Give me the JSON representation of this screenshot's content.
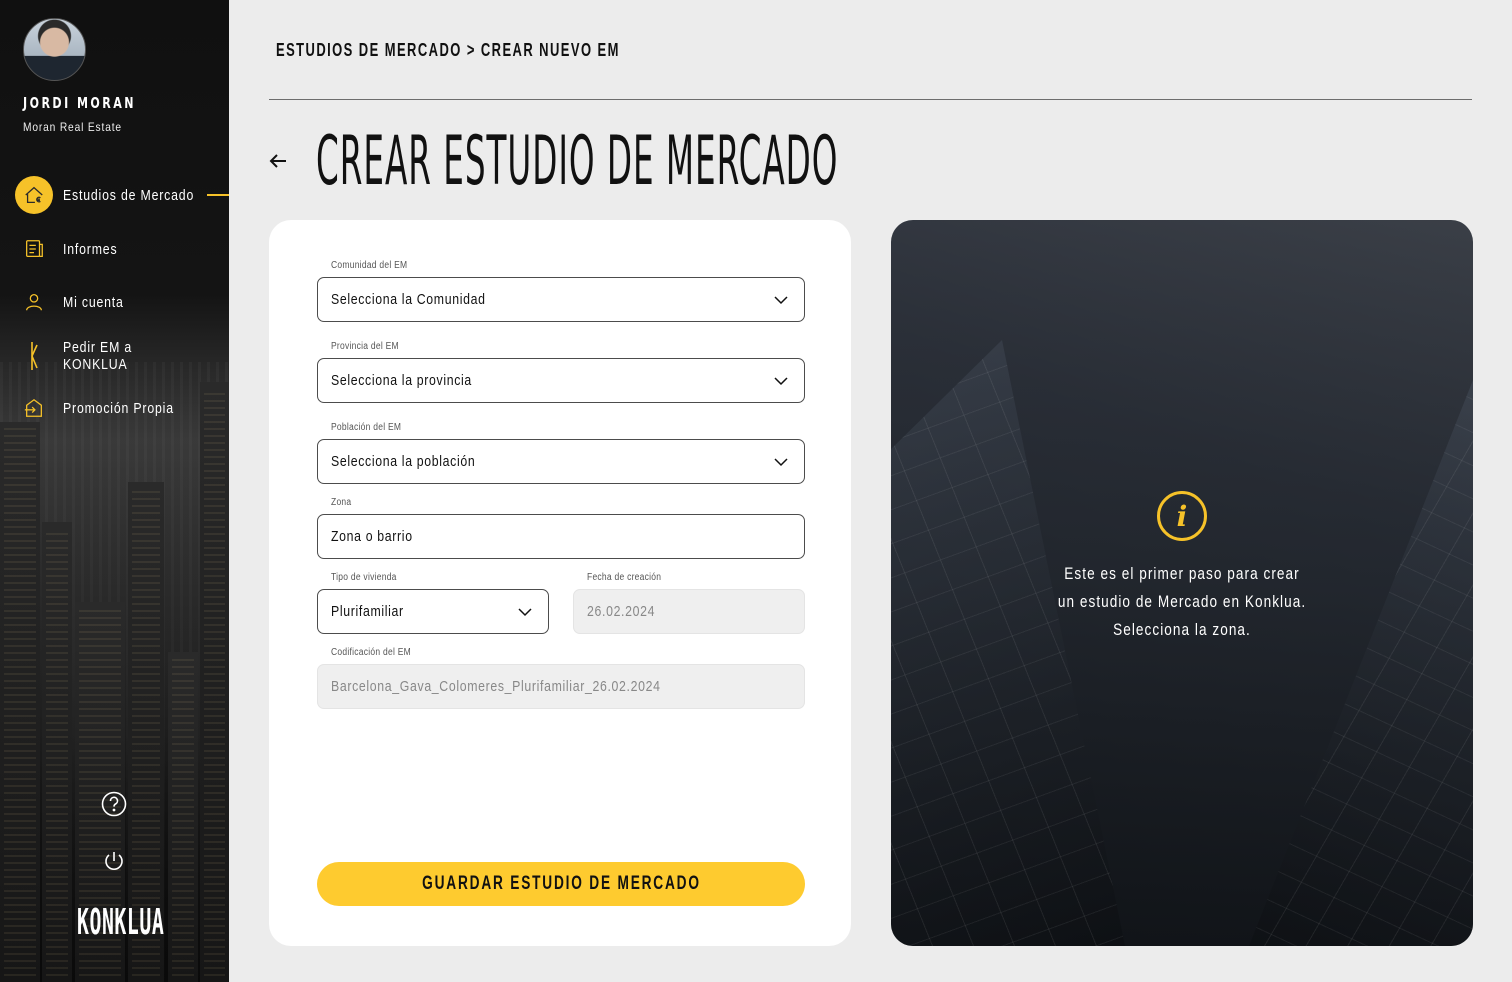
{
  "user": {
    "name": "JORDI MORAN",
    "company": "Moran Real Estate"
  },
  "sidebar": {
    "items": [
      {
        "label": "Estudios de Mercado",
        "icon": "house-euro-icon",
        "active": true
      },
      {
        "label": "Informes",
        "icon": "report-icon"
      },
      {
        "label": "Mi cuenta",
        "icon": "user-icon"
      },
      {
        "label": "Pedir EM a KONKLUA",
        "icon": "konklua-k-icon"
      },
      {
        "label": "Promoción Propia",
        "icon": "house-enter-icon"
      }
    ],
    "logo": "KONKLUA"
  },
  "header": {
    "breadcrumb": "ESTUDIOS DE MERCADO > CREAR NUEVO EM",
    "title": "CREAR ESTUDIO DE MERCADO"
  },
  "form": {
    "comunidad": {
      "label": "Comunidad del EM",
      "value": "Selecciona la Comunidad"
    },
    "provincia": {
      "label": "Provincia del EM",
      "value": "Selecciona la provincia"
    },
    "poblacion": {
      "label": "Población del EM",
      "value": "Selecciona la población"
    },
    "zona": {
      "label": "Zona",
      "placeholder": "Zona o barrio"
    },
    "tipo": {
      "label": "Tipo de vivienda",
      "value": "Plurifamiliar"
    },
    "fecha": {
      "label": "Fecha de creación",
      "value": "26.02.2024"
    },
    "codificacion": {
      "label": "Codificación del EM",
      "value": "Barcelona_Gava_Colomeres_Plurifamiliar_26.02.2024"
    },
    "save_label": "GUARDAR ESTUDIO DE MERCADO"
  },
  "info": {
    "lines": [
      "Este es el primer paso para crear",
      "un estudio de Mercado en Konklua.",
      "Selecciona la zona."
    ]
  },
  "colors": {
    "accent": "#f6c229",
    "button": "#fecb2f",
    "sidebar_bg": "#111111",
    "page_bg": "#ececec"
  }
}
